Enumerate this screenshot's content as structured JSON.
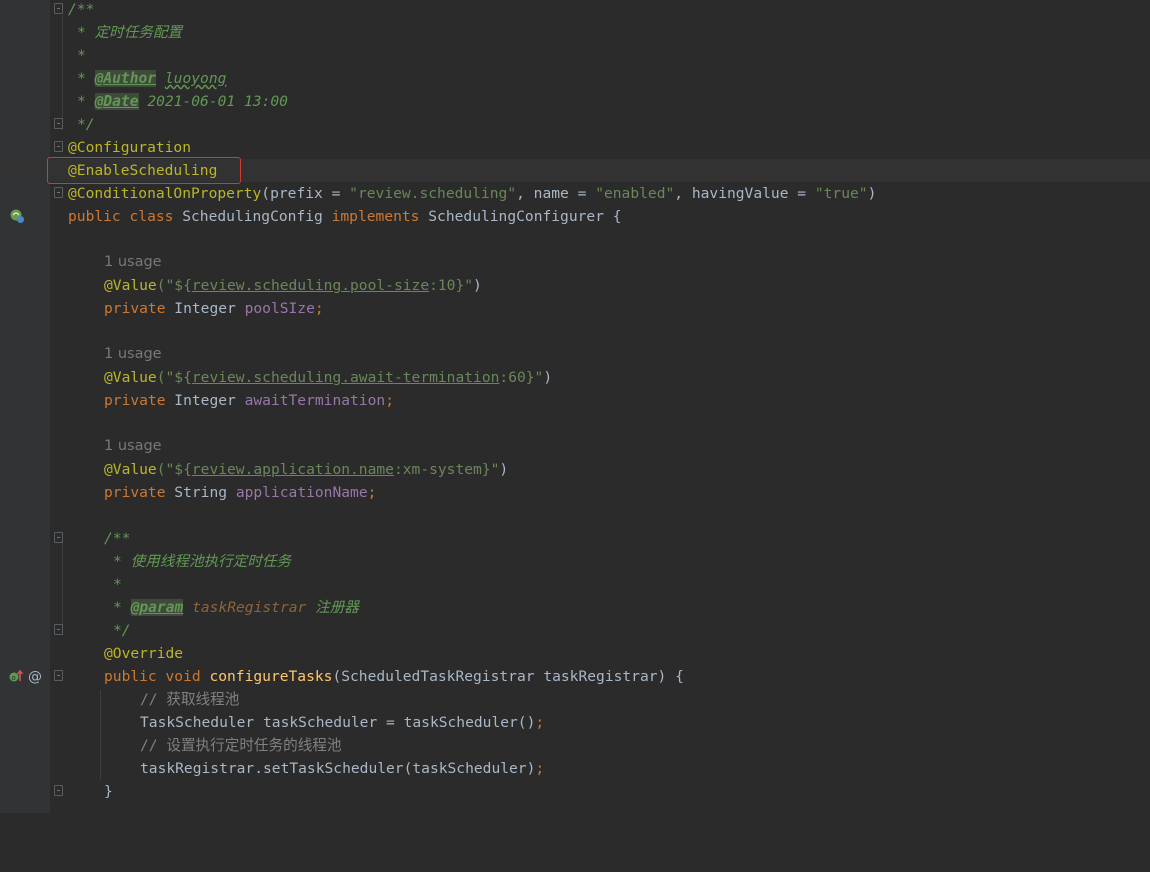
{
  "editor": {
    "doc_comment": {
      "open": "/**",
      "title": "* 定时任务配置",
      "star": "*",
      "author_tag": "@Author",
      "author_value": "luoyong",
      "date_tag": "@Date",
      "date_value": "2021-06-01 13:00",
      "close": "*/"
    },
    "annotations": {
      "configuration": "@Configuration",
      "enable_scheduling": "@EnableScheduling",
      "conditional_name": "@ConditionalOnProperty",
      "conditional_prefix_key": "(prefix = ",
      "conditional_prefix_val": "\"review.scheduling\"",
      "conditional_name_key": ", name = ",
      "conditional_name_val": "\"enabled\"",
      "conditional_having_key": ", havingValue = ",
      "conditional_having_val": "\"true\"",
      "conditional_close": ")"
    },
    "class_decl": {
      "kw_public_class": "public class ",
      "name": "SchedulingConfig ",
      "kw_implements": "implements ",
      "iface": "SchedulingConfigurer {"
    },
    "fields": [
      {
        "usage": "1 usage",
        "anno": "@Value",
        "quote_open": "(\"${",
        "placeholder": "review.scheduling.pool-size",
        "default": ":10}\"",
        "paren_close": ")",
        "kw": "private ",
        "type": "Integer ",
        "name": "poolSIze",
        "semi": ";"
      },
      {
        "usage": "1 usage",
        "anno": "@Value",
        "quote_open": "(\"${",
        "placeholder": "review.scheduling.await-termination",
        "default": ":60}\"",
        "paren_close": ")",
        "kw": "private ",
        "type": "Integer ",
        "name": "awaitTermination",
        "semi": ";"
      },
      {
        "usage": "1 usage",
        "anno": "@Value",
        "quote_open": "(\"${",
        "placeholder": "review.application.name",
        "default": ":xm-system}\"",
        "paren_close": ")",
        "kw": "private ",
        "type": "String ",
        "name": "applicationName",
        "semi": ";"
      }
    ],
    "method_doc": {
      "open": "/**",
      "desc": "* 使用线程池执行定时任务",
      "star": "*",
      "param_star": "* ",
      "param_tag": "@param",
      "param_name": " taskRegistrar",
      "param_desc": " 注册器",
      "close": "*/"
    },
    "method": {
      "override": "@Override",
      "kw": "public void ",
      "name": "configureTasks",
      "params": "(ScheduledTaskRegistrar taskRegistrar) {",
      "comment1": "// 获取线程池",
      "stmt1_a": "TaskScheduler taskScheduler = taskScheduler()",
      "stmt1_semi": ";",
      "comment2": "// 设置执行定时任务的线程池",
      "stmt2_a": "taskRegistrar.setTaskScheduler(taskScheduler)",
      "stmt2_semi": ";",
      "close": "}"
    },
    "gutter_icons": [
      "bean-icon",
      "override-up-icon",
      "at-sign-icon"
    ],
    "colors": {
      "background": "#2b2b2b",
      "gutter": "#313335",
      "highlight_box": "#d23a32",
      "annotation": "#bbb529",
      "keyword": "#cc7832",
      "string": "#6a8759",
      "field": "#9876aa",
      "method": "#ffc66d",
      "doc_comment": "#629755",
      "line_comment": "#808080",
      "text": "#a9b7c6"
    }
  }
}
